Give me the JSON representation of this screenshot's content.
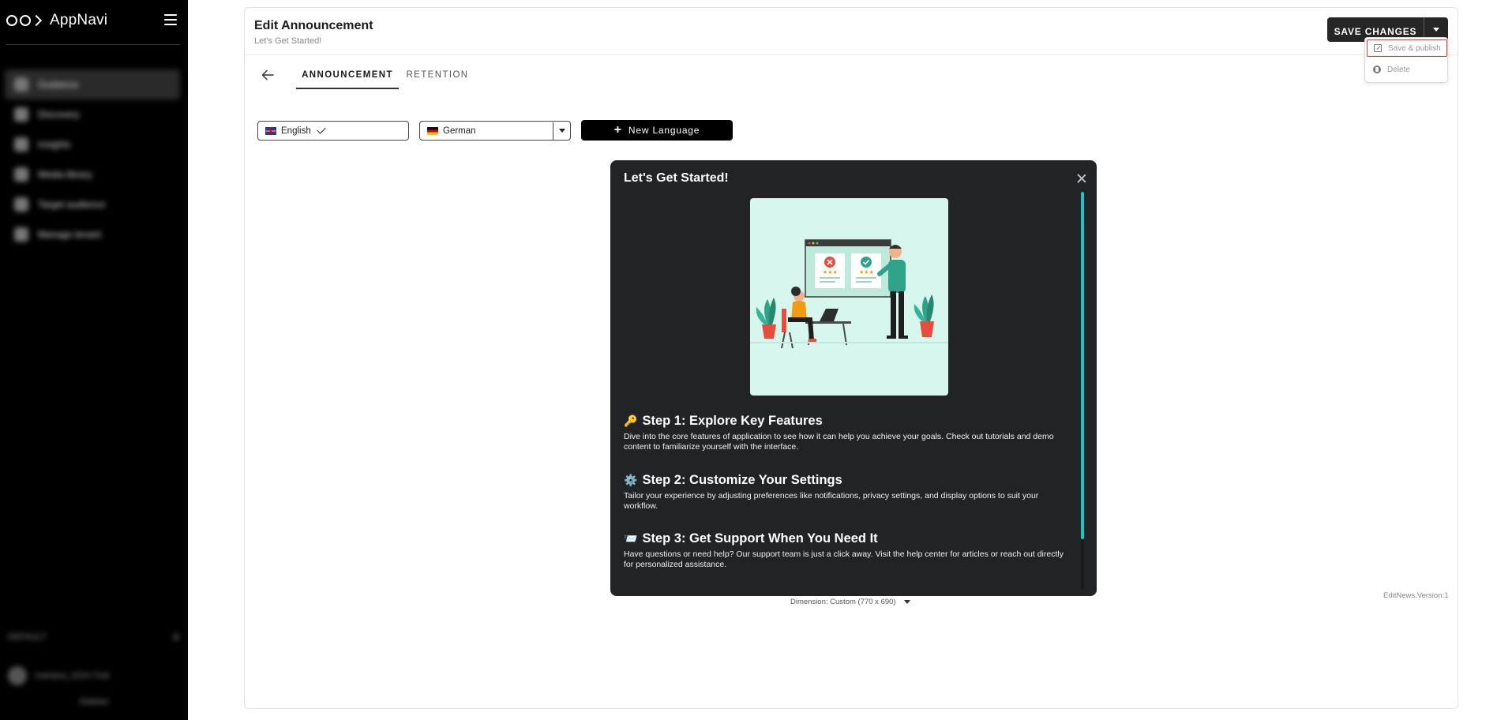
{
  "app": {
    "name": "AppNavi"
  },
  "sidebar": {
    "items": [
      {
        "label": "Guidance"
      },
      {
        "label": "Discovery"
      },
      {
        "label": "Insights"
      },
      {
        "label": "Media library"
      },
      {
        "label": "Target audience"
      },
      {
        "label": "Manage tenant"
      }
    ],
    "bottom": {
      "section": "DEFAULT",
      "user": "mariana_2024 Trial",
      "footer": "Sidebar"
    }
  },
  "header": {
    "title": "Edit Announcement",
    "subtitle": "Let's Get Started!",
    "save_label": "SAVE CHANGES",
    "menu": [
      {
        "label": "Save & publish",
        "icon": "edit-icon"
      },
      {
        "label": "Delete",
        "icon": "delete-icon"
      }
    ]
  },
  "tabs": [
    {
      "label": "ANNOUNCEMENT",
      "active": true
    },
    {
      "label": "RETENTION",
      "active": false
    }
  ],
  "languages": {
    "primary": "English",
    "secondary": "German",
    "new_label": "New Language"
  },
  "preview": {
    "title": "Let's Get Started!",
    "steps": [
      {
        "emoji": "🔑",
        "title": "Step 1: Explore Key Features",
        "body": "Dive into the core features of application to see how it can help you achieve your goals. Check out tutorials and demo content to familiarize yourself with the interface."
      },
      {
        "emoji": "⚙️",
        "title": "Step 2: Customize Your Settings",
        "body": "Tailor your experience by adjusting preferences like notifications, privacy settings, and display options to suit your workflow."
      },
      {
        "emoji": "📨",
        "title": "Step 3: Get Support When You Need It",
        "body": "Have questions or need help? Our support team is just a click away. Visit the help center for articles or reach out directly for personalized assistance."
      }
    ]
  },
  "dimension_label": "Dimension: Custom (770 x 690)",
  "version_label": "EditNews.Version:1",
  "colors": {
    "accent": "#14c8cc",
    "dark": "#262626",
    "highlight": "#e53935"
  }
}
